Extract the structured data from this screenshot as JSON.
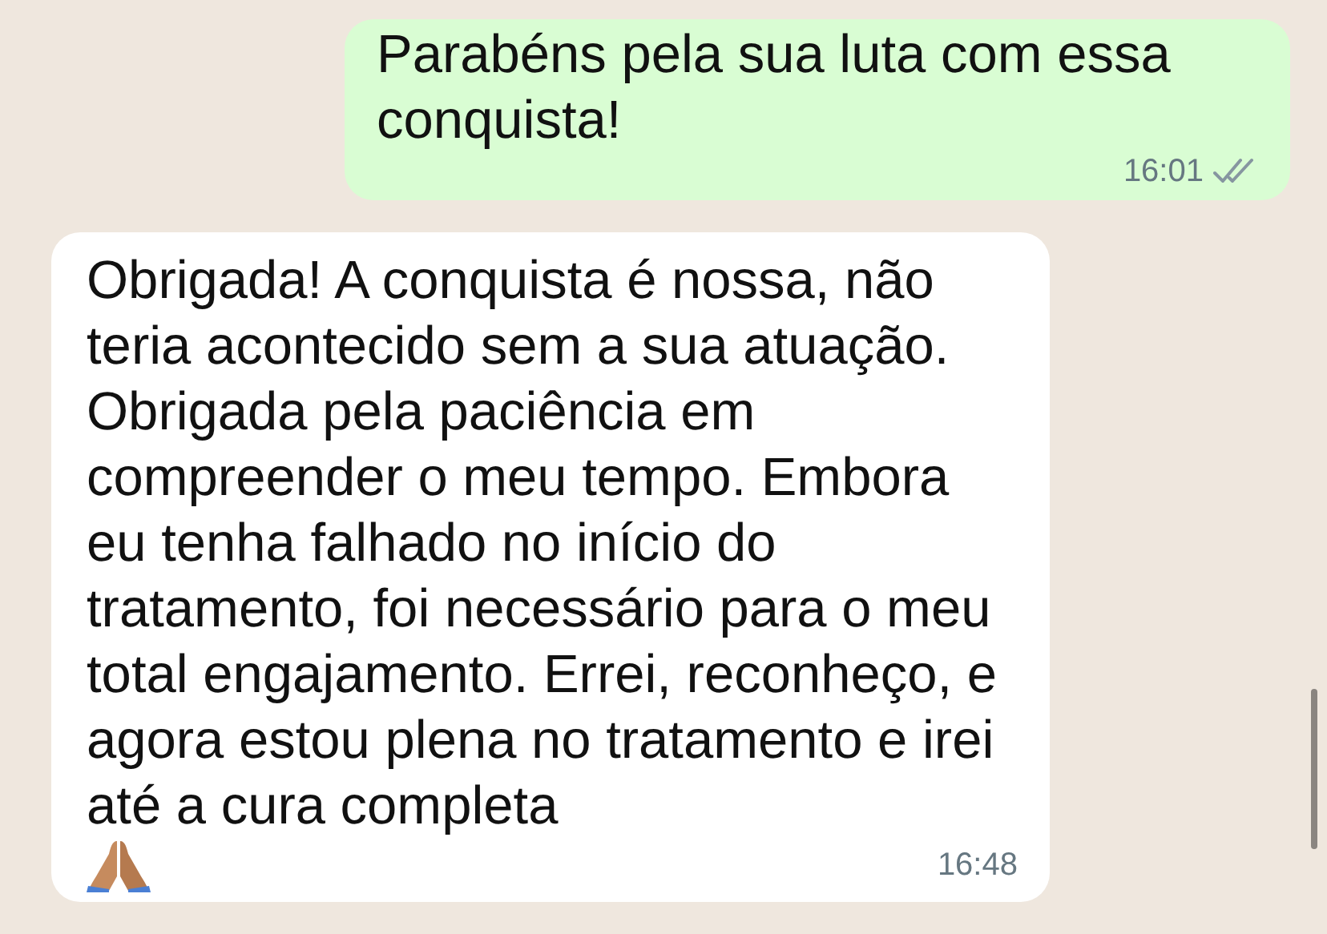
{
  "messages": [
    {
      "kind": "sent",
      "text": "Parabéns pela sua luta com essa conquista!",
      "time": "16:01",
      "read": false
    },
    {
      "kind": "received",
      "text": "Obrigada! A conquista é nossa, não teria acontecido sem a sua atuação. Obrigada pela paciência em compreender o meu tempo. Embora eu tenha falhado no início do tratamento, foi necessário para o meu total engajamento. Errei, reconheço, e agora estou plena no tratamento e irei até a cura completa",
      "time": "16:48",
      "has_emoji": true
    }
  ]
}
